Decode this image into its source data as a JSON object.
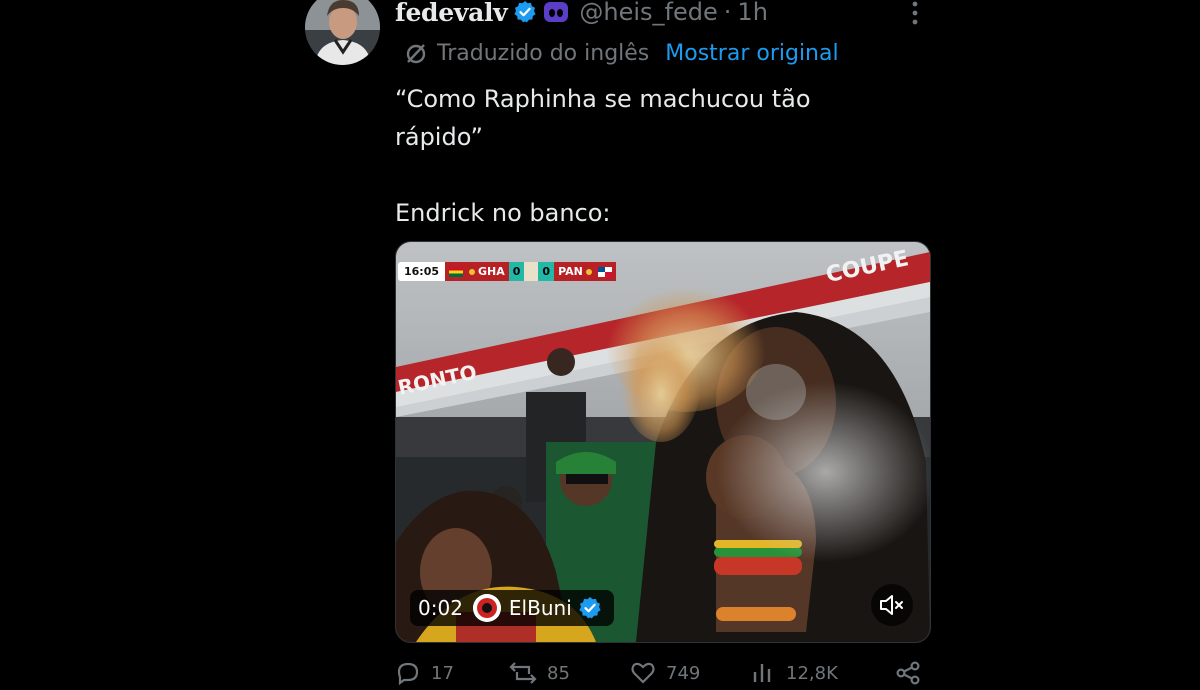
{
  "tweet": {
    "display_name": "fedevalv",
    "handle": "@heis_fede",
    "separator": "·",
    "time": "1h",
    "translated_label": "Traduzido do inglês",
    "show_original": "Mostrar original",
    "text": "“Como Raphinha se machucou tão\nrápido”\n\nEndrick no banco:"
  },
  "video": {
    "time": "0:02",
    "source_name": "ElBuni",
    "scorebug": {
      "clock": "16:05",
      "home": "GHA",
      "home_score": "0",
      "away_score": "0",
      "away": "PAN"
    },
    "banner_text": "COUPE",
    "stand_text": "RONTO"
  },
  "actions": {
    "replies": "17",
    "reposts": "85",
    "likes": "749",
    "views": "12,8K"
  },
  "colors": {
    "background": "#000000",
    "text": "#e7e9ea",
    "secondary": "#71767b",
    "link": "#1d9bf0",
    "verified": "#1d9bf0",
    "affiliate_badge": "#5b3ec8"
  },
  "icons": {
    "verified": "verified-badge-icon",
    "affiliate": "affiliate-badge-icon",
    "more": "more-dots-icon",
    "translate": "translate-icon",
    "mute": "mute-icon",
    "reply": "reply-icon",
    "repost": "repost-icon",
    "like": "heart-icon",
    "views": "views-icon",
    "share": "share-icon"
  }
}
